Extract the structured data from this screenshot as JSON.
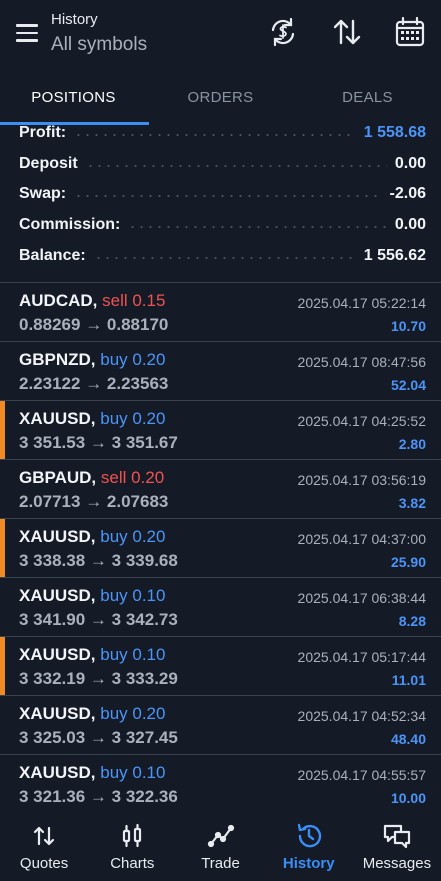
{
  "header": {
    "title": "History",
    "subtitle": "All symbols"
  },
  "tabs": [
    {
      "label": "POSITIONS",
      "active": true
    },
    {
      "label": "ORDERS",
      "active": false
    },
    {
      "label": "DEALS",
      "active": false
    }
  ],
  "summary": {
    "profit": {
      "label": "Profit:",
      "value": "1 558.68"
    },
    "deposit": {
      "label": "Deposit",
      "value": "0.00"
    },
    "swap": {
      "label": "Swap:",
      "value": "-2.06"
    },
    "commission": {
      "label": "Commission:",
      "value": "0.00"
    },
    "balance": {
      "label": "Balance:",
      "value": "1 556.62"
    }
  },
  "deals": [
    {
      "symbol": "AUDCAD,",
      "direction": "sell 0.15",
      "type": "sell",
      "open": "0.88269",
      "close": "0.88170",
      "time": "2025.04.17 05:22:14",
      "profit": "10.70",
      "marked": false
    },
    {
      "symbol": "GBPNZD,",
      "direction": "buy 0.20",
      "type": "buy",
      "open": "2.23122",
      "close": "2.23563",
      "time": "2025.04.17 08:47:56",
      "profit": "52.04",
      "marked": false
    },
    {
      "symbol": "XAUUSD,",
      "direction": "buy 0.20",
      "type": "buy",
      "open": "3 351.53",
      "close": "3 351.67",
      "time": "2025.04.17 04:25:52",
      "profit": "2.80",
      "marked": true
    },
    {
      "symbol": "GBPAUD,",
      "direction": "sell 0.20",
      "type": "sell",
      "open": "2.07713",
      "close": "2.07683",
      "time": "2025.04.17 03:56:19",
      "profit": "3.82",
      "marked": false
    },
    {
      "symbol": "XAUUSD,",
      "direction": "buy 0.20",
      "type": "buy",
      "open": "3 338.38",
      "close": "3 339.68",
      "time": "2025.04.17 04:37:00",
      "profit": "25.90",
      "marked": true
    },
    {
      "symbol": "XAUUSD,",
      "direction": "buy 0.10",
      "type": "buy",
      "open": "3 341.90",
      "close": "3 342.73",
      "time": "2025.04.17 06:38:44",
      "profit": "8.28",
      "marked": false
    },
    {
      "symbol": "XAUUSD,",
      "direction": "buy 0.10",
      "type": "buy",
      "open": "3 332.19",
      "close": "3 333.29",
      "time": "2025.04.17 05:17:44",
      "profit": "11.01",
      "marked": true
    },
    {
      "symbol": "XAUUSD,",
      "direction": "buy 0.20",
      "type": "buy",
      "open": "3 325.03",
      "close": "3 327.45",
      "time": "2025.04.17 04:52:34",
      "profit": "48.40",
      "marked": false
    },
    {
      "symbol": "XAUUSD,",
      "direction": "buy 0.10",
      "type": "buy",
      "open": "3 321.36",
      "close": "3 322.36",
      "time": "2025.04.17 04:55:57",
      "profit": "10.00",
      "marked": false
    }
  ],
  "arrow": "→",
  "nav": [
    {
      "label": "Quotes",
      "icon": "quotes-icon",
      "active": false
    },
    {
      "label": "Charts",
      "icon": "charts-icon",
      "active": false
    },
    {
      "label": "Trade",
      "icon": "trade-icon",
      "active": false
    },
    {
      "label": "History",
      "icon": "history-icon",
      "active": true
    },
    {
      "label": "Messages",
      "icon": "messages-icon",
      "active": false
    }
  ],
  "colors": {
    "background": "#141b27",
    "accent": "#3a8ef5",
    "buy": "#4d94f7",
    "sell": "#f0524f",
    "marker": "#f08a24"
  }
}
